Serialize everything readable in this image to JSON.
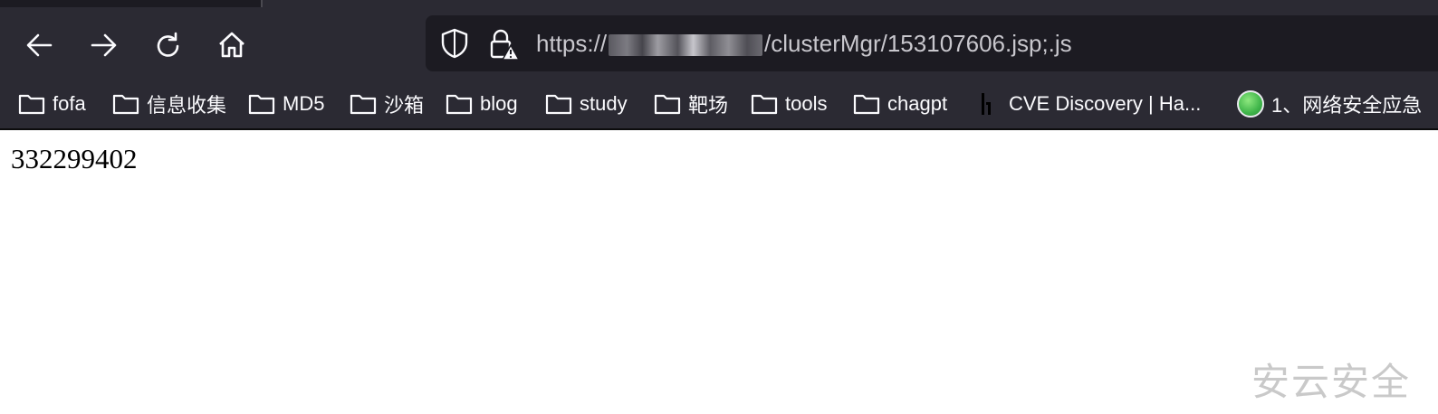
{
  "browser": {
    "nav": {
      "back_icon": "arrow-left-icon",
      "forward_icon": "arrow-right-icon",
      "reload_icon": "reload-icon",
      "home_icon": "home-icon"
    },
    "urlbar": {
      "scheme": "https://",
      "host_redacted_tail": "/clusterMgr/153107606.jsp;.js",
      "shield_icon": "shield-icon",
      "lock_icon": "lock-warning-icon"
    },
    "bookmarks": [
      {
        "label": "fofa",
        "icon": "folder-icon"
      },
      {
        "label": "信息收集",
        "icon": "folder-icon"
      },
      {
        "label": "MD5",
        "icon": "folder-icon"
      },
      {
        "label": "沙箱",
        "icon": "folder-icon"
      },
      {
        "label": "blog",
        "icon": "folder-icon"
      },
      {
        "label": "study",
        "icon": "folder-icon"
      },
      {
        "label": "靶场",
        "icon": "folder-icon"
      },
      {
        "label": "tools",
        "icon": "folder-icon"
      },
      {
        "label": "chagpt",
        "icon": "folder-icon"
      },
      {
        "label": "CVE Discovery | Ha...",
        "icon": "site-favicon-icon"
      },
      {
        "label": "1、网络安全应急",
        "icon": "green-globe-icon"
      }
    ],
    "colors": {
      "toolbar": "#2b2a33",
      "urlbar": "#1c1b22",
      "text": "#fbfbfe"
    }
  },
  "page": {
    "body_text": "332299402",
    "watermark": "安云安全"
  }
}
